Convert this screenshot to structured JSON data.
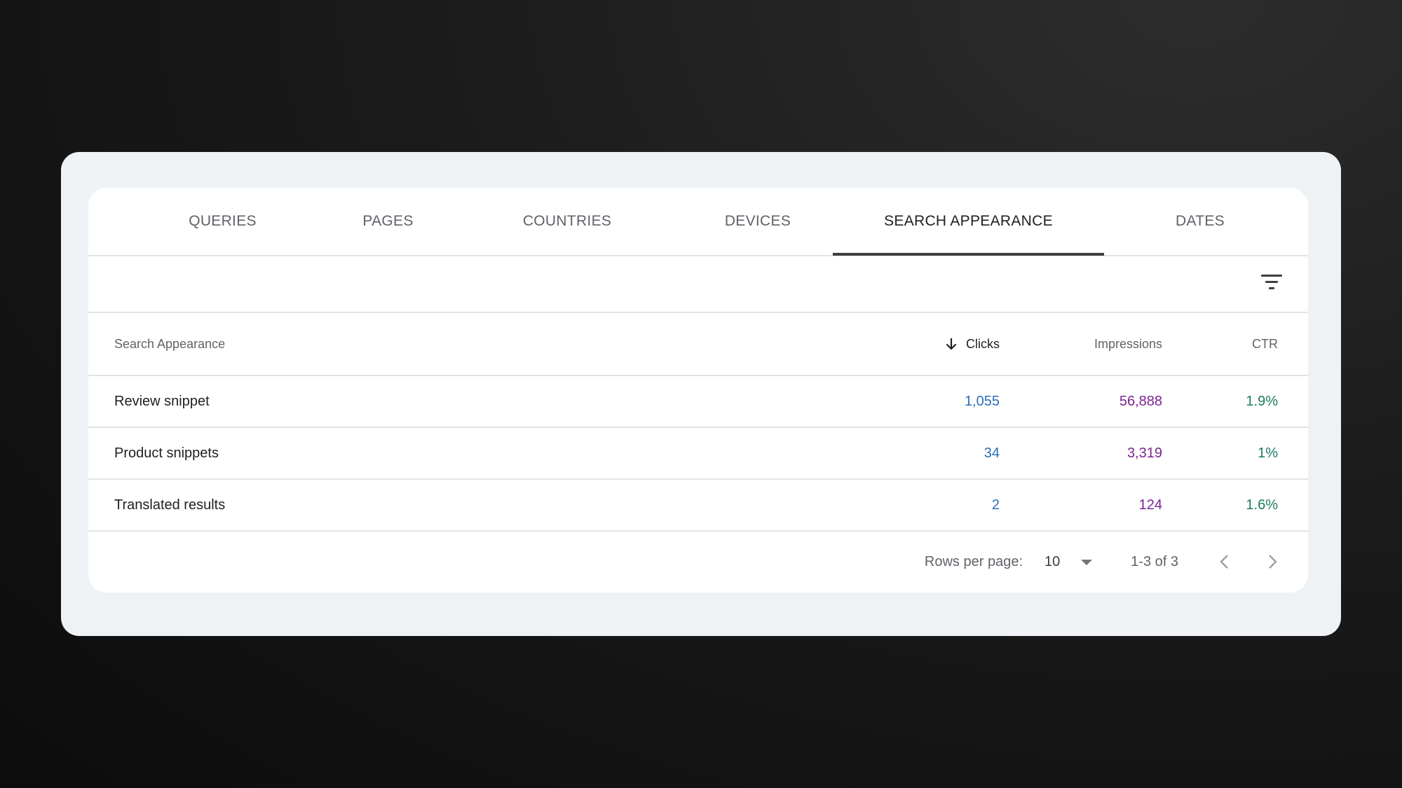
{
  "tabs": [
    {
      "label": "QUERIES",
      "active": false
    },
    {
      "label": "PAGES",
      "active": false
    },
    {
      "label": "COUNTRIES",
      "active": false
    },
    {
      "label": "DEVICES",
      "active": false
    },
    {
      "label": "SEARCH APPEARANCE",
      "active": true
    },
    {
      "label": "DATES",
      "active": false
    }
  ],
  "toolbar": {
    "filter_icon": "filter-list-icon"
  },
  "table": {
    "columns": {
      "name": "Search Appearance",
      "clicks": "Clicks",
      "impressions": "Impressions",
      "ctr": "CTR"
    },
    "sorted_by": "clicks",
    "sort_icon": "arrow-downward-icon",
    "rows": [
      {
        "name": "Review snippet",
        "clicks": "1,055",
        "impressions": "56,888",
        "ctr": "1.9%"
      },
      {
        "name": "Product snippets",
        "clicks": "34",
        "impressions": "3,319",
        "ctr": "1%"
      },
      {
        "name": "Translated results",
        "clicks": "2",
        "impressions": "124",
        "ctr": "1.6%"
      }
    ]
  },
  "pagination": {
    "rows_per_page_label": "Rows per page:",
    "rows_per_page_value": "10",
    "range_text": "1-3 of 3",
    "prev_icon": "chevron-left-icon",
    "next_icon": "chevron-right-icon"
  },
  "colors": {
    "clicks": "#2a6fb8",
    "impressions": "#7b2593",
    "ctr": "#1c7a62",
    "active_tab_indicator": "#3c4043"
  }
}
